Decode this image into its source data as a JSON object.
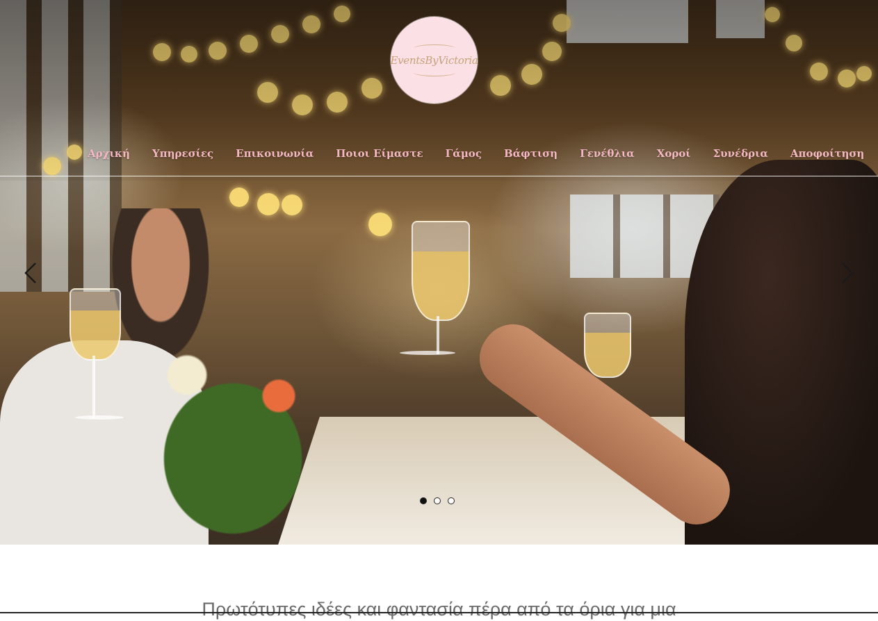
{
  "brand": {
    "logo_text": "EventsByVictoria",
    "logo_color": "#fbe1e6"
  },
  "nav": {
    "items": [
      "Αρχική",
      "Υπηρεσίες",
      "Επικοινωνία",
      "Ποιοι Είμαστε",
      "Γάμος",
      "Βάφτιση",
      "Γενέθλια",
      "Χοροί",
      "Συνέδρια",
      "Αποφοίτηση"
    ],
    "text_color": "#f4b8c2"
  },
  "slider": {
    "prev_icon": "chevron-left-icon",
    "next_icon": "chevron-right-icon",
    "slide_count": 3,
    "active_index": 0
  },
  "intro": {
    "text": "Πρωτότυπες ιδέες και φαντασία πέρα από τα όρια για μια"
  }
}
